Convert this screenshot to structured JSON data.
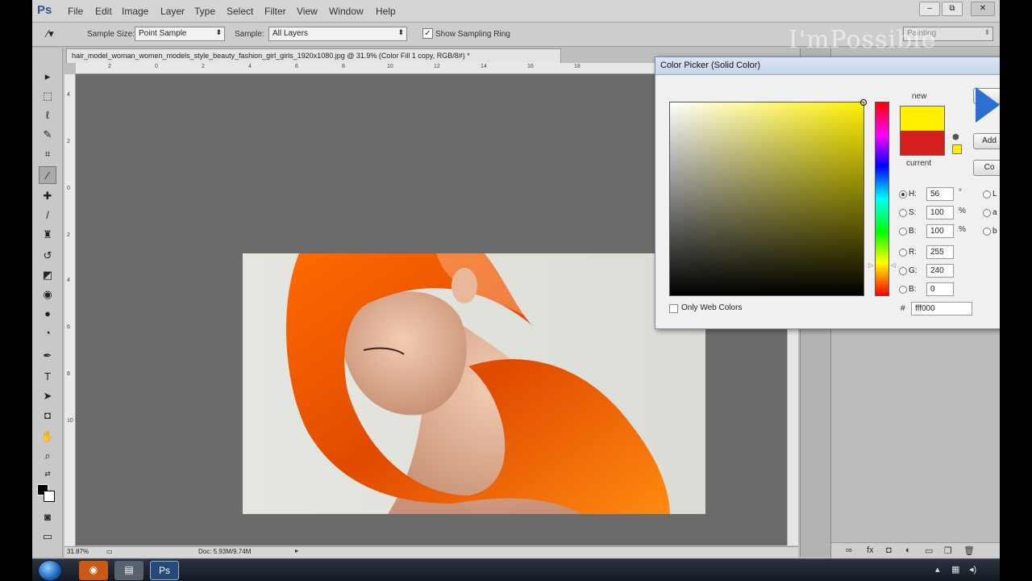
{
  "menubar": {
    "logo": "Ps",
    "items": [
      "File",
      "Edit",
      "Image",
      "Layer",
      "Type",
      "Select",
      "Filter",
      "View",
      "Window",
      "Help"
    ],
    "window_buttons": [
      "–",
      "⧉",
      "✕"
    ]
  },
  "options_bar": {
    "sample_size_label": "Sample Size:",
    "sample_size_value": "Point Sample",
    "sample_label": "Sample:",
    "sample_value": "All Layers",
    "show_ring_label": "Show Sampling Ring",
    "show_ring_checked": true,
    "watermark": "I'mPossible",
    "workspace_value": "Painting"
  },
  "document": {
    "tab_title": "hair_model_woman_women_models_style_beauty_fashion_girl_girls_1920x1080.jpg @ 31.9% (Color Fill 1 copy, RGB/8#) *",
    "ruler_h_labels": [
      "2",
      "0",
      "2",
      "4",
      "6",
      "8",
      "10",
      "12",
      "14",
      "16",
      "18"
    ],
    "ruler_v_labels": [
      "4",
      "2",
      "0",
      "2",
      "4",
      "6",
      "8",
      "10"
    ],
    "zoom": "31.87%",
    "doc_size": "Doc: 5.93M/9.74M"
  },
  "color_picker": {
    "title": "Color Picker (Solid Color)",
    "new_label": "new",
    "current_label": "current",
    "new_color": "#fff000",
    "current_color": "#d41f1f",
    "buttons": {
      "ok": "",
      "cancel": "",
      "add": "Add",
      "libraries": "Co"
    },
    "fields": [
      {
        "label": "H:",
        "value": "56",
        "unit": "°",
        "selected": true
      },
      {
        "label": "S:",
        "value": "100",
        "unit": "%",
        "selected": false
      },
      {
        "label": "B:",
        "value": "100",
        "unit": "%",
        "selected": false
      },
      {
        "label": "R:",
        "value": "255",
        "unit": "",
        "selected": false
      },
      {
        "label": "G:",
        "value": "240",
        "unit": "",
        "selected": false
      },
      {
        "label": "B:",
        "value": "0",
        "unit": "",
        "selected": false
      }
    ],
    "lab_labels": [
      "L",
      "a",
      "b"
    ],
    "only_web_label": "Only Web Colors",
    "hex_label": "#",
    "hex_value": "fff000"
  },
  "taskbar": {
    "apps": [
      "firefox",
      "explorer",
      "photoshop"
    ]
  },
  "colors": {
    "accent": "#2d5a8f",
    "canvas": "#6b6b6b"
  }
}
